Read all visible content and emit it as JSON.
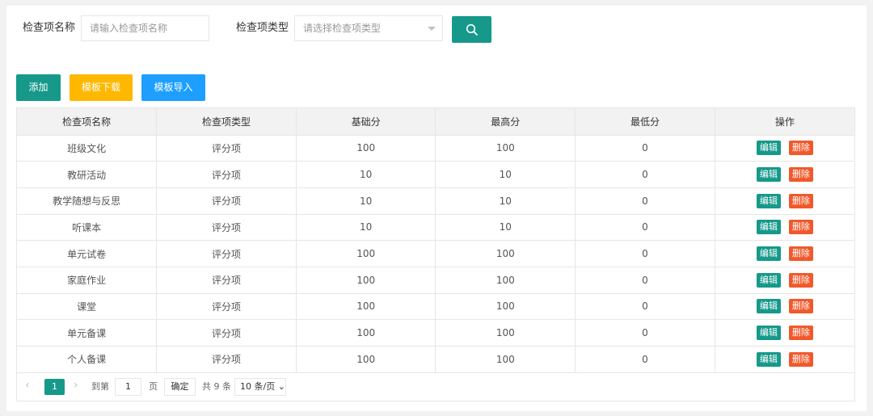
{
  "filters": {
    "name_label": "检查项名称",
    "name_placeholder": "请输入检查项名称",
    "type_label": "检查项类型",
    "type_placeholder": "请选择检查项类型"
  },
  "actions": {
    "add": "添加",
    "download_template": "模板下载",
    "import_template": "模板导入"
  },
  "colors": {
    "primary": "#16998a",
    "warning": "#ffb800",
    "info": "#1e9fff",
    "danger": "#f0592b"
  },
  "table": {
    "headers": [
      "检查项名称",
      "检查项类型",
      "基础分",
      "最高分",
      "最低分",
      "操作"
    ],
    "edit_label": "编辑",
    "delete_label": "删除",
    "rows": [
      [
        "班级文化",
        "评分项",
        "100",
        "100",
        "0"
      ],
      [
        "教研活动",
        "评分项",
        "10",
        "10",
        "0"
      ],
      [
        "教学随想与反思",
        "评分项",
        "10",
        "10",
        "0"
      ],
      [
        "听课本",
        "评分项",
        "10",
        "10",
        "0"
      ],
      [
        "单元试卷",
        "评分项",
        "100",
        "100",
        "0"
      ],
      [
        "家庭作业",
        "评分项",
        "100",
        "100",
        "0"
      ],
      [
        "课堂",
        "评分项",
        "100",
        "100",
        "0"
      ],
      [
        "单元备课",
        "评分项",
        "100",
        "100",
        "0"
      ],
      [
        "个人备课",
        "评分项",
        "100",
        "100",
        "0"
      ]
    ]
  },
  "pager": {
    "prev": "‹",
    "current": "1",
    "next": "›",
    "goto_label": "到第",
    "goto_value": "1",
    "page_unit": "页",
    "confirm": "确定",
    "total": "共 9 条",
    "page_size": "10 条/页"
  }
}
